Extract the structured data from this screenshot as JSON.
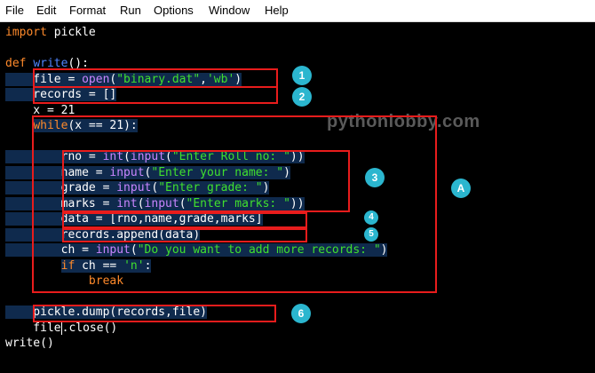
{
  "menu": [
    "File",
    "Edit",
    "Format",
    "Run",
    "Options",
    "Window",
    "Help"
  ],
  "watermark": "pythonlobby.com",
  "colors": {
    "keyword": "#ff8a2b",
    "builtin": "#c985ff",
    "string": "#40e02e",
    "definition": "#4f86ff",
    "text": "#ffffff",
    "highlight": "#0f2a4d",
    "annotation_box": "#e81c1c",
    "badge": "#2bb6cf",
    "background": "#000000"
  },
  "badges": [
    "1",
    "2",
    "3",
    "4",
    "5",
    "6",
    "A"
  ],
  "code_lines": [
    [
      [
        "import",
        "kw"
      ],
      [
        " pickle",
        "pl"
      ]
    ],
    [],
    [
      [
        "def",
        "kw"
      ],
      [
        " ",
        "pl"
      ],
      [
        "write",
        "def"
      ],
      [
        "():",
        "pl"
      ]
    ],
    [
      [
        "    file = ",
        "pl"
      ],
      [
        "open",
        "bi"
      ],
      [
        "(",
        "pl"
      ],
      [
        "\"binary.dat\"",
        "str"
      ],
      [
        ",",
        "pl"
      ],
      [
        "'wb'",
        "str"
      ],
      [
        ")",
        "pl"
      ]
    ],
    [
      [
        "    records = []",
        "pl"
      ]
    ],
    [
      [
        "    x = 21",
        "pl"
      ]
    ],
    [
      [
        "    ",
        "pl"
      ],
      [
        "while",
        "kw"
      ],
      [
        "(x == 21):",
        "pl"
      ]
    ],
    [],
    [
      [
        "        rno = ",
        "pl"
      ],
      [
        "int",
        "bi"
      ],
      [
        "(",
        "pl"
      ],
      [
        "input",
        "bi"
      ],
      [
        "(",
        "pl"
      ],
      [
        "\"Enter Roll no: \"",
        "str"
      ],
      [
        "))",
        "pl"
      ]
    ],
    [
      [
        "        name = ",
        "pl"
      ],
      [
        "input",
        "bi"
      ],
      [
        "(",
        "pl"
      ],
      [
        "\"Enter your name: \"",
        "str"
      ],
      [
        ")",
        "pl"
      ]
    ],
    [
      [
        "        grade = ",
        "pl"
      ],
      [
        "input",
        "bi"
      ],
      [
        "(",
        "pl"
      ],
      [
        "\"Enter grade: \"",
        "str"
      ],
      [
        ")",
        "pl"
      ]
    ],
    [
      [
        "        marks = ",
        "pl"
      ],
      [
        "int",
        "bi"
      ],
      [
        "(",
        "pl"
      ],
      [
        "input",
        "bi"
      ],
      [
        "(",
        "pl"
      ],
      [
        "\"Enter marks: \"",
        "str"
      ],
      [
        "))",
        "pl"
      ]
    ],
    [
      [
        "        data = [rno,name,grade,marks]",
        "pl"
      ]
    ],
    [
      [
        "        records.append(data)",
        "pl"
      ]
    ],
    [
      [
        "        ch = ",
        "pl"
      ],
      [
        "input",
        "bi"
      ],
      [
        "(",
        "pl"
      ],
      [
        "\"Do you want to add more records: \"",
        "str"
      ],
      [
        ")",
        "pl"
      ]
    ],
    [
      [
        "        ",
        "pl"
      ],
      [
        "if",
        "kw"
      ],
      [
        " ch == ",
        "pl"
      ],
      [
        "'n'",
        "str"
      ],
      [
        ":",
        "pl"
      ]
    ],
    [
      [
        "            ",
        "pl"
      ],
      [
        "break",
        "kw"
      ]
    ],
    [],
    [
      [
        "    pickle.dump(records,file)",
        "pl"
      ]
    ],
    [
      [
        "    file",
        "pl"
      ],
      [
        "|",
        "cursor"
      ],
      [
        ".close()",
        "pl"
      ]
    ],
    [
      [
        "write()",
        "pl"
      ]
    ]
  ]
}
